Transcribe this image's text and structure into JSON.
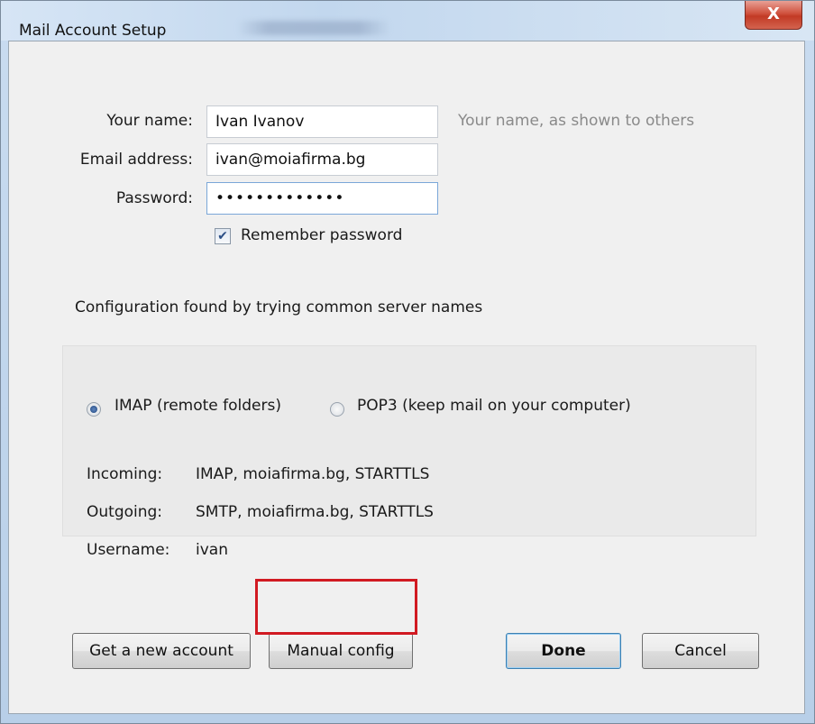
{
  "window": {
    "title": "Mail Account Setup",
    "close_glyph": "X"
  },
  "form": {
    "name_label": "Your name:",
    "name_value": "Ivan Ivanov",
    "name_hint": "Your name, as shown to others",
    "email_label": "Email address:",
    "email_value": "ivan@moiafirma.bg",
    "password_label": "Password:",
    "password_value": "•••••••••••••",
    "remember_label": "Remember password",
    "remember_checked": true
  },
  "status_text": "Configuration found by trying common server names",
  "config": {
    "protocols": [
      {
        "label": "IMAP (remote folders)",
        "selected": true
      },
      {
        "label": "POP3 (keep mail on your computer)",
        "selected": false
      }
    ],
    "incoming_label": "Incoming:",
    "incoming_value": "IMAP, moiafirma.bg, STARTTLS",
    "outgoing_label": "Outgoing:",
    "outgoing_value": "SMTP, moiafirma.bg, STARTTLS",
    "username_label": "Username:",
    "username_value": "ivan"
  },
  "buttons": {
    "get_new_account": "Get a new account",
    "manual_config": "Manual config",
    "done": "Done",
    "cancel": "Cancel"
  },
  "colors": {
    "highlight_border": "#d11a22",
    "close_button": "#c23a25"
  }
}
